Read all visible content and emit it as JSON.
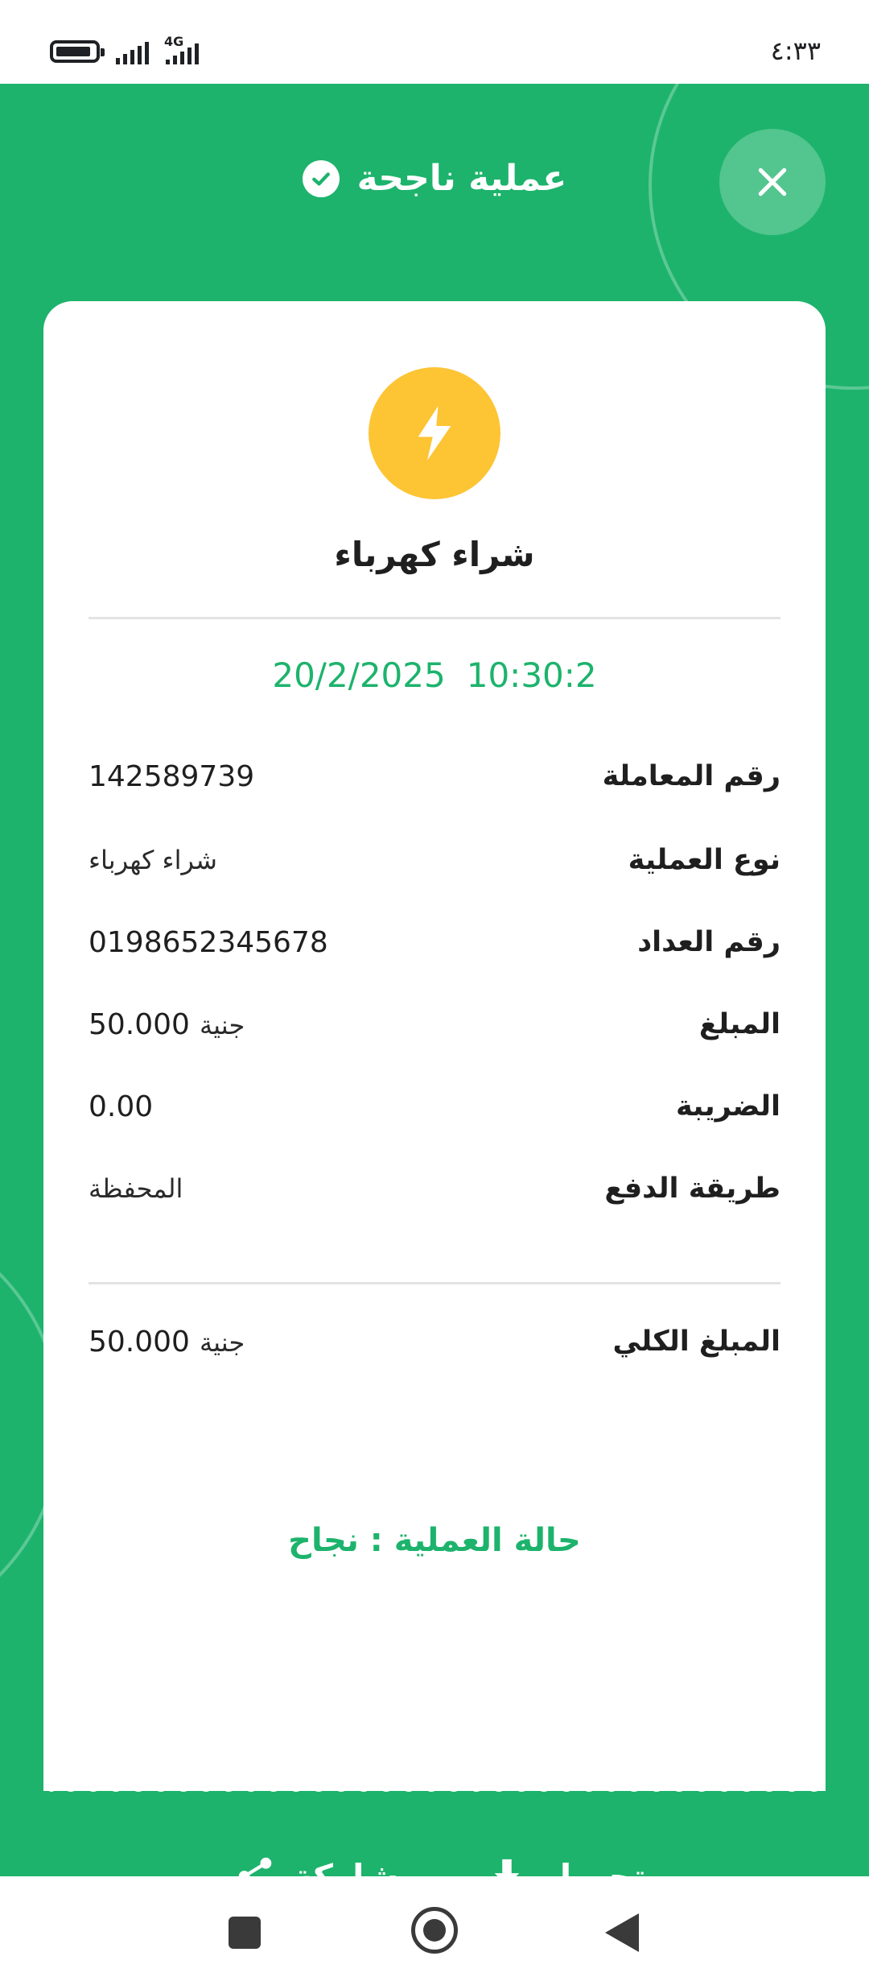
{
  "status_bar": {
    "time": "٤:٣٣",
    "network": "4G",
    "icons": [
      "battery-icon",
      "signal-icon",
      "signal-4g-icon"
    ]
  },
  "header": {
    "title": "عملية ناجحة",
    "title_icon": "check-circle-icon",
    "close_icon": "close-icon"
  },
  "receipt": {
    "service_icon": "lightning-bolt-icon",
    "service_title": "شراء كهرباء",
    "date": "20/2/2025",
    "time": "10:30:2",
    "rows": [
      {
        "label": "رقم المعاملة",
        "value": "142589739"
      },
      {
        "label": "نوع العملية",
        "value": "شراء كهرباء"
      },
      {
        "label": "رقم العداد",
        "value": "0198652345678"
      },
      {
        "label": "المبلغ",
        "value": "50.000",
        "currency": "جنية"
      },
      {
        "label": "الضريبة",
        "value": "0.00"
      },
      {
        "label": "طريقة الدفع",
        "value": "المحفظة"
      }
    ],
    "total": {
      "label": "المبلغ الكلي",
      "value": "50.000",
      "currency": "جنية"
    },
    "status": "حالة العملية : نجاح"
  },
  "actions": {
    "share_label": "مشاركة",
    "share_icon": "share-icon",
    "download_label": "تحميل",
    "download_icon": "download-icon"
  },
  "nav_bar": {
    "icons": [
      "recent-apps-icon",
      "home-icon",
      "back-icon"
    ]
  },
  "colors": {
    "primary_green": "#1db36c",
    "accent_yellow": "#fdc434",
    "card_white": "#ffffff"
  }
}
